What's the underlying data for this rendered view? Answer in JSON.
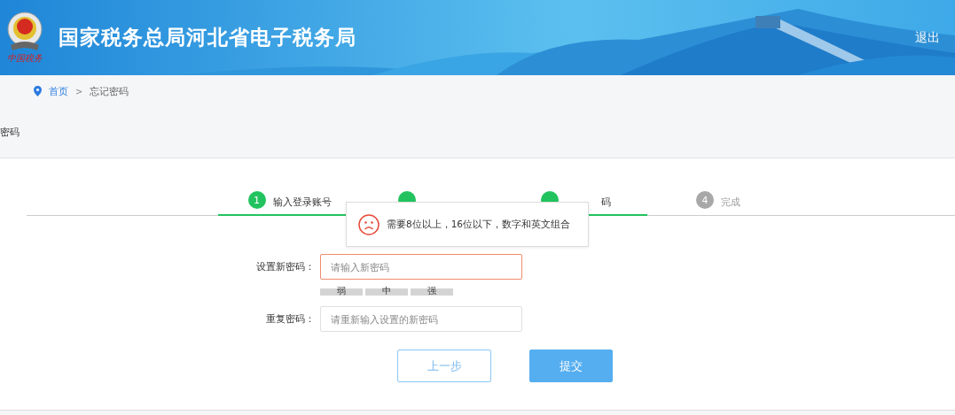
{
  "header": {
    "logo_caption": "中国税务",
    "title": "国家税务总局河北省电子税务局",
    "logout": "退出"
  },
  "breadcrumb": [
    {
      "label": "首页",
      "kind": "link"
    },
    {
      "label": ">",
      "kind": "separator"
    },
    {
      "label": "忘记密码",
      "kind": "current"
    }
  ],
  "page_title": "密码",
  "steps": [
    {
      "number": "1",
      "label": "输入登录账号",
      "done": true
    },
    {
      "covered": true,
      "done": true
    },
    {
      "label": "码",
      "covered": true,
      "done": true
    },
    {
      "number": "4",
      "label": "完成",
      "done": false
    }
  ],
  "tooltip": {
    "text": "需要8位以上，16位以下，数字和英文组合"
  },
  "form": [
    {
      "label": "设置新密码：",
      "placeholder": "请输入新密码",
      "error": true
    },
    {
      "label": "重复密码：",
      "placeholder": "请重新输入设置的新密码",
      "error": false
    }
  ],
  "strength": [
    {
      "label": "弱",
      "on": false
    },
    {
      "label": "中",
      "on": false
    },
    {
      "label": "强",
      "on": false
    }
  ],
  "buttons": [
    {
      "label": "上一步",
      "kind": "secondary"
    },
    {
      "label": "提交",
      "kind": "primary"
    }
  ]
}
